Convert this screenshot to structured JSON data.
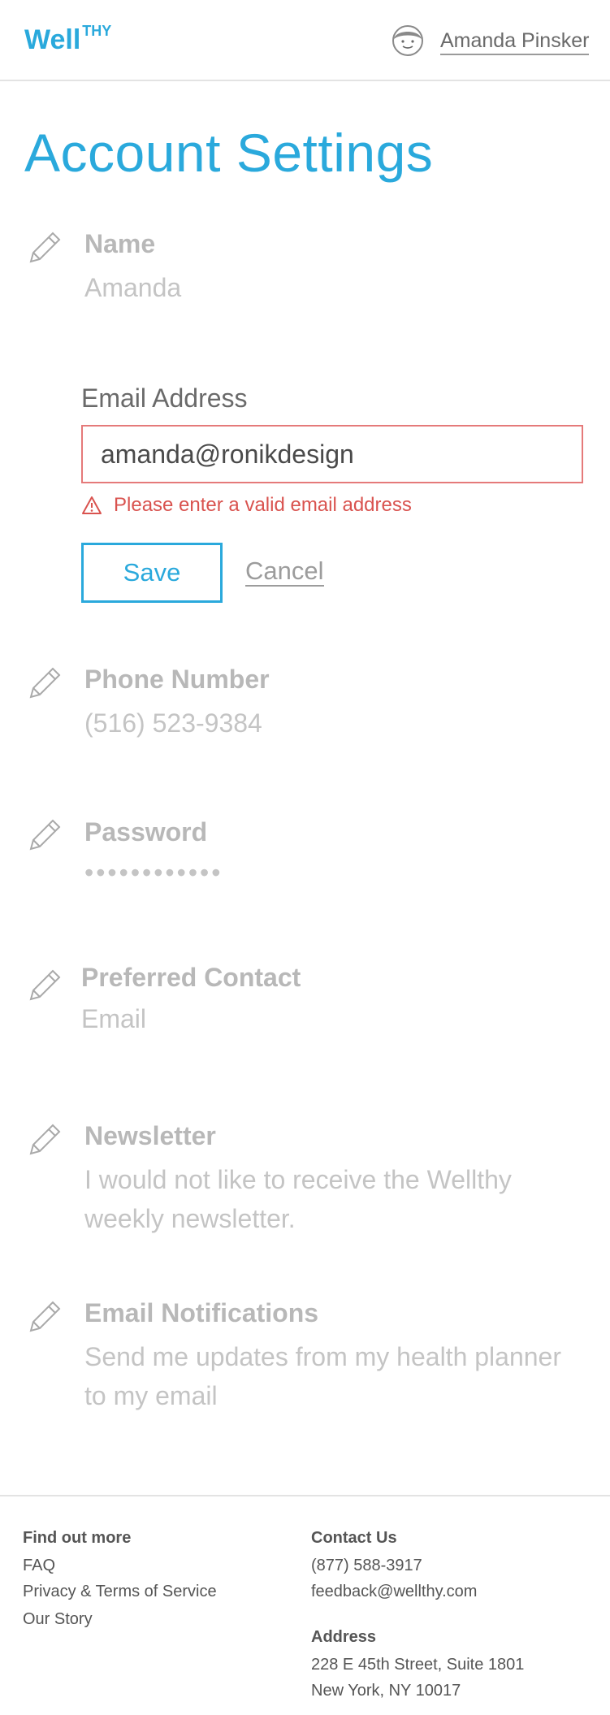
{
  "header": {
    "logo_main": "Well",
    "logo_sup": "THY",
    "user_name": "Amanda Pinsker"
  },
  "page_title": "Account Settings",
  "fields": {
    "name": {
      "label": "Name",
      "value": "Amanda"
    },
    "email": {
      "label": "Email Address",
      "value": "amanda@ronikdesign",
      "error": "Please enter a valid email address",
      "save_label": "Save",
      "cancel_label": "Cancel"
    },
    "phone": {
      "label": "Phone Number",
      "value": "(516) 523-9384"
    },
    "password": {
      "label": "Password",
      "value": "••••••••••••"
    },
    "preferred_contact": {
      "label": "Preferred Contact",
      "value": "Email"
    },
    "newsletter": {
      "label": "Newsletter",
      "value": "I would not like to receive the Wellthy weekly newsletter."
    },
    "notifications": {
      "label": "Email Notifications",
      "value": "Send me updates from my health planner to my email"
    }
  },
  "footer": {
    "find_out_more": {
      "heading": "Find out more",
      "links": [
        "FAQ",
        "Privacy & Terms of Service",
        "Our Story"
      ]
    },
    "contact": {
      "heading": "Contact Us",
      "phone": "(877) 588-3917",
      "email": "feedback@wellthy.com"
    },
    "address": {
      "heading": "Address",
      "line1": "228 E 45th Street, Suite 1801",
      "line2": "New York, NY 10017"
    }
  },
  "colors": {
    "brand": "#2aa9dc",
    "error": "#d9534f",
    "muted": "#b8b8b8"
  },
  "icons": [
    "pencil-icon",
    "avatar-icon",
    "warning-icon"
  ]
}
